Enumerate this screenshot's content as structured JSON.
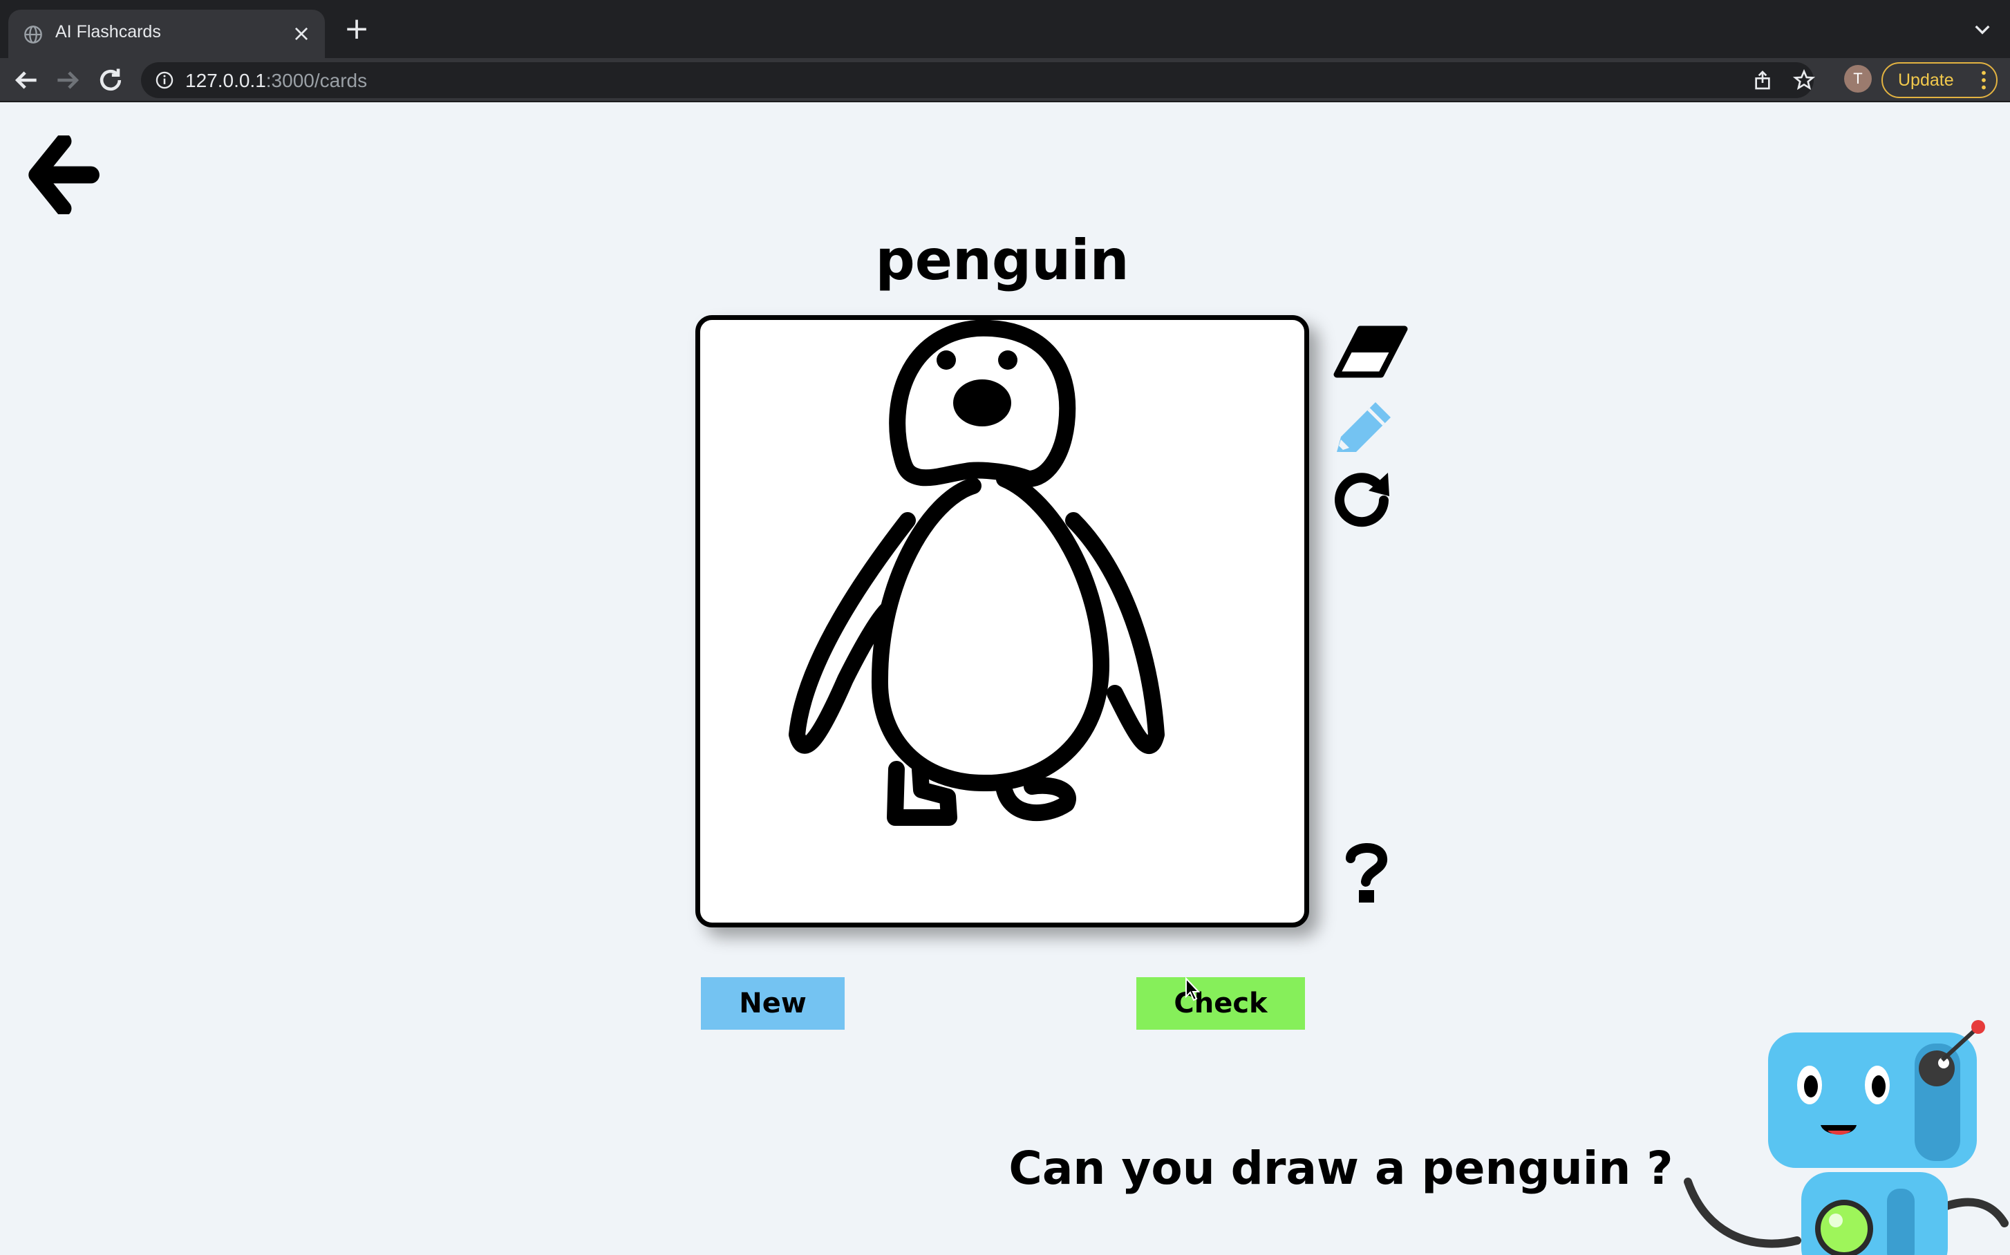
{
  "browser": {
    "tab_title": "AI Flashcards",
    "url_host": "127.0.0.1",
    "url_path": ":3000/cards",
    "avatar_initial": "T",
    "update_label": "Update"
  },
  "page": {
    "card_word": "penguin",
    "new_label": "New",
    "check_label": "Check",
    "prompt_text": "Can you draw a penguin ?",
    "help_symbol": "?"
  },
  "colors": {
    "background": "#f0f4f8",
    "new_button": "#74c3f2",
    "check_button": "#86ef5a",
    "pencil_active": "#74c3f2",
    "robot_blue": "#59c4f2"
  },
  "tools": [
    "eraser-icon",
    "pencil-icon",
    "redo-icon",
    "help-icon"
  ]
}
